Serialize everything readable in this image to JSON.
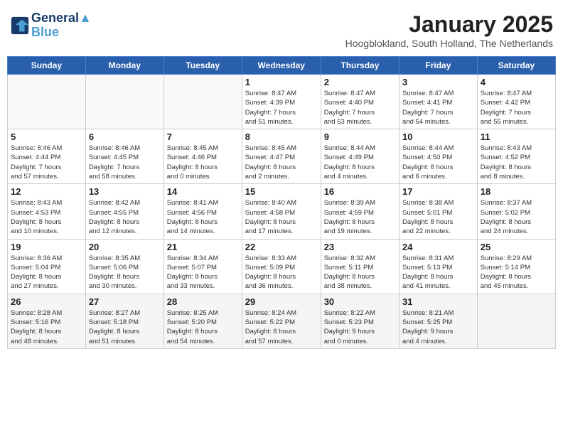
{
  "header": {
    "logo_line1": "General",
    "logo_line2": "Blue",
    "month": "January 2025",
    "location": "Hoogblokland, South Holland, The Netherlands"
  },
  "weekdays": [
    "Sunday",
    "Monday",
    "Tuesday",
    "Wednesday",
    "Thursday",
    "Friday",
    "Saturday"
  ],
  "weeks": [
    [
      {
        "day": "",
        "info": ""
      },
      {
        "day": "",
        "info": ""
      },
      {
        "day": "",
        "info": ""
      },
      {
        "day": "1",
        "info": "Sunrise: 8:47 AM\nSunset: 4:39 PM\nDaylight: 7 hours\nand 51 minutes."
      },
      {
        "day": "2",
        "info": "Sunrise: 8:47 AM\nSunset: 4:40 PM\nDaylight: 7 hours\nand 53 minutes."
      },
      {
        "day": "3",
        "info": "Sunrise: 8:47 AM\nSunset: 4:41 PM\nDaylight: 7 hours\nand 54 minutes."
      },
      {
        "day": "4",
        "info": "Sunrise: 8:47 AM\nSunset: 4:42 PM\nDaylight: 7 hours\nand 55 minutes."
      }
    ],
    [
      {
        "day": "5",
        "info": "Sunrise: 8:46 AM\nSunset: 4:44 PM\nDaylight: 7 hours\nand 57 minutes."
      },
      {
        "day": "6",
        "info": "Sunrise: 8:46 AM\nSunset: 4:45 PM\nDaylight: 7 hours\nand 58 minutes."
      },
      {
        "day": "7",
        "info": "Sunrise: 8:45 AM\nSunset: 4:46 PM\nDaylight: 8 hours\nand 0 minutes."
      },
      {
        "day": "8",
        "info": "Sunrise: 8:45 AM\nSunset: 4:47 PM\nDaylight: 8 hours\nand 2 minutes."
      },
      {
        "day": "9",
        "info": "Sunrise: 8:44 AM\nSunset: 4:49 PM\nDaylight: 8 hours\nand 4 minutes."
      },
      {
        "day": "10",
        "info": "Sunrise: 8:44 AM\nSunset: 4:50 PM\nDaylight: 8 hours\nand 6 minutes."
      },
      {
        "day": "11",
        "info": "Sunrise: 8:43 AM\nSunset: 4:52 PM\nDaylight: 8 hours\nand 8 minutes."
      }
    ],
    [
      {
        "day": "12",
        "info": "Sunrise: 8:43 AM\nSunset: 4:53 PM\nDaylight: 8 hours\nand 10 minutes."
      },
      {
        "day": "13",
        "info": "Sunrise: 8:42 AM\nSunset: 4:55 PM\nDaylight: 8 hours\nand 12 minutes."
      },
      {
        "day": "14",
        "info": "Sunrise: 8:41 AM\nSunset: 4:56 PM\nDaylight: 8 hours\nand 14 minutes."
      },
      {
        "day": "15",
        "info": "Sunrise: 8:40 AM\nSunset: 4:58 PM\nDaylight: 8 hours\nand 17 minutes."
      },
      {
        "day": "16",
        "info": "Sunrise: 8:39 AM\nSunset: 4:59 PM\nDaylight: 8 hours\nand 19 minutes."
      },
      {
        "day": "17",
        "info": "Sunrise: 8:38 AM\nSunset: 5:01 PM\nDaylight: 8 hours\nand 22 minutes."
      },
      {
        "day": "18",
        "info": "Sunrise: 8:37 AM\nSunset: 5:02 PM\nDaylight: 8 hours\nand 24 minutes."
      }
    ],
    [
      {
        "day": "19",
        "info": "Sunrise: 8:36 AM\nSunset: 5:04 PM\nDaylight: 8 hours\nand 27 minutes."
      },
      {
        "day": "20",
        "info": "Sunrise: 8:35 AM\nSunset: 5:06 PM\nDaylight: 8 hours\nand 30 minutes."
      },
      {
        "day": "21",
        "info": "Sunrise: 8:34 AM\nSunset: 5:07 PM\nDaylight: 8 hours\nand 33 minutes."
      },
      {
        "day": "22",
        "info": "Sunrise: 8:33 AM\nSunset: 5:09 PM\nDaylight: 8 hours\nand 36 minutes."
      },
      {
        "day": "23",
        "info": "Sunrise: 8:32 AM\nSunset: 5:11 PM\nDaylight: 8 hours\nand 38 minutes."
      },
      {
        "day": "24",
        "info": "Sunrise: 8:31 AM\nSunset: 5:13 PM\nDaylight: 8 hours\nand 41 minutes."
      },
      {
        "day": "25",
        "info": "Sunrise: 8:29 AM\nSunset: 5:14 PM\nDaylight: 8 hours\nand 45 minutes."
      }
    ],
    [
      {
        "day": "26",
        "info": "Sunrise: 8:28 AM\nSunset: 5:16 PM\nDaylight: 8 hours\nand 48 minutes."
      },
      {
        "day": "27",
        "info": "Sunrise: 8:27 AM\nSunset: 5:18 PM\nDaylight: 8 hours\nand 51 minutes."
      },
      {
        "day": "28",
        "info": "Sunrise: 8:25 AM\nSunset: 5:20 PM\nDaylight: 8 hours\nand 54 minutes."
      },
      {
        "day": "29",
        "info": "Sunrise: 8:24 AM\nSunset: 5:22 PM\nDaylight: 8 hours\nand 57 minutes."
      },
      {
        "day": "30",
        "info": "Sunrise: 8:22 AM\nSunset: 5:23 PM\nDaylight: 9 hours\nand 0 minutes."
      },
      {
        "day": "31",
        "info": "Sunrise: 8:21 AM\nSunset: 5:25 PM\nDaylight: 9 hours\nand 4 minutes."
      },
      {
        "day": "",
        "info": ""
      }
    ]
  ]
}
